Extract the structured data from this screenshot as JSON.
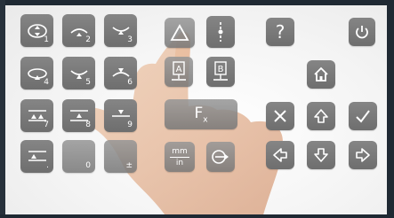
{
  "keypad": {
    "digits": {
      "k1": "1",
      "k2": "2",
      "k3": "3",
      "k4": "4",
      "k5": "5",
      "k6": "6",
      "k7": "7",
      "k8": "8",
      "k9": "9",
      "k0": "0",
      "kdot": ".",
      "kpm": "±"
    },
    "help_label": "?",
    "function_label_main": "F",
    "function_label_sub": "x",
    "unit_top": "mm",
    "unit_bottom": "in",
    "marker_a": "A",
    "marker_b": "B"
  },
  "icons": {
    "help": "question-mark-icon",
    "power": "power-icon",
    "home": "home-icon",
    "cancel": "close-icon",
    "ok": "check-icon",
    "up": "arrow-up-icon",
    "down": "arrow-down-icon",
    "left": "arrow-left-icon",
    "right": "arrow-right-icon",
    "tolerance": "triangle-icon",
    "measure": "vertical-measure-icon",
    "preset": "preset-arrow-icon"
  },
  "colors": {
    "key": "#7a7a7a",
    "frame": "#1f2933"
  }
}
